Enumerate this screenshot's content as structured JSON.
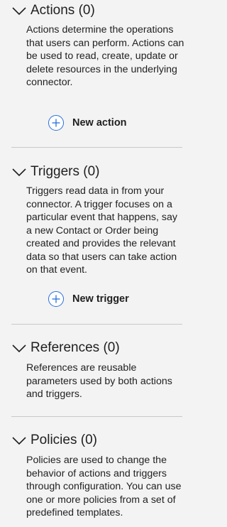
{
  "sections": [
    {
      "title": "Actions (0)",
      "description": "Actions determine the operations that users can perform. Actions can be used to read, create, update or delete resources in the underlying connector.",
      "button_label": "New action"
    },
    {
      "title": "Triggers (0)",
      "description": "Triggers read data in from your connector. A trigger focuses on a particular event that happens, say a new Contact or Order being created and provides the relevant data so that users can take action on that event.",
      "button_label": "New trigger"
    },
    {
      "title": "References (0)",
      "description": "References are reusable parameters used by both actions and triggers."
    },
    {
      "title": "Policies (0)",
      "description": "Policies are used to change the behavior of actions and triggers through configuration. You can use one or more policies from a set of predefined templates."
    }
  ],
  "colors": {
    "background": "#f3f3f3",
    "accent": "#2a6fdb",
    "divider": "#c9c9c9"
  },
  "icons": {
    "collapse": "chevron-down-icon",
    "add": "plus-circle-icon"
  }
}
